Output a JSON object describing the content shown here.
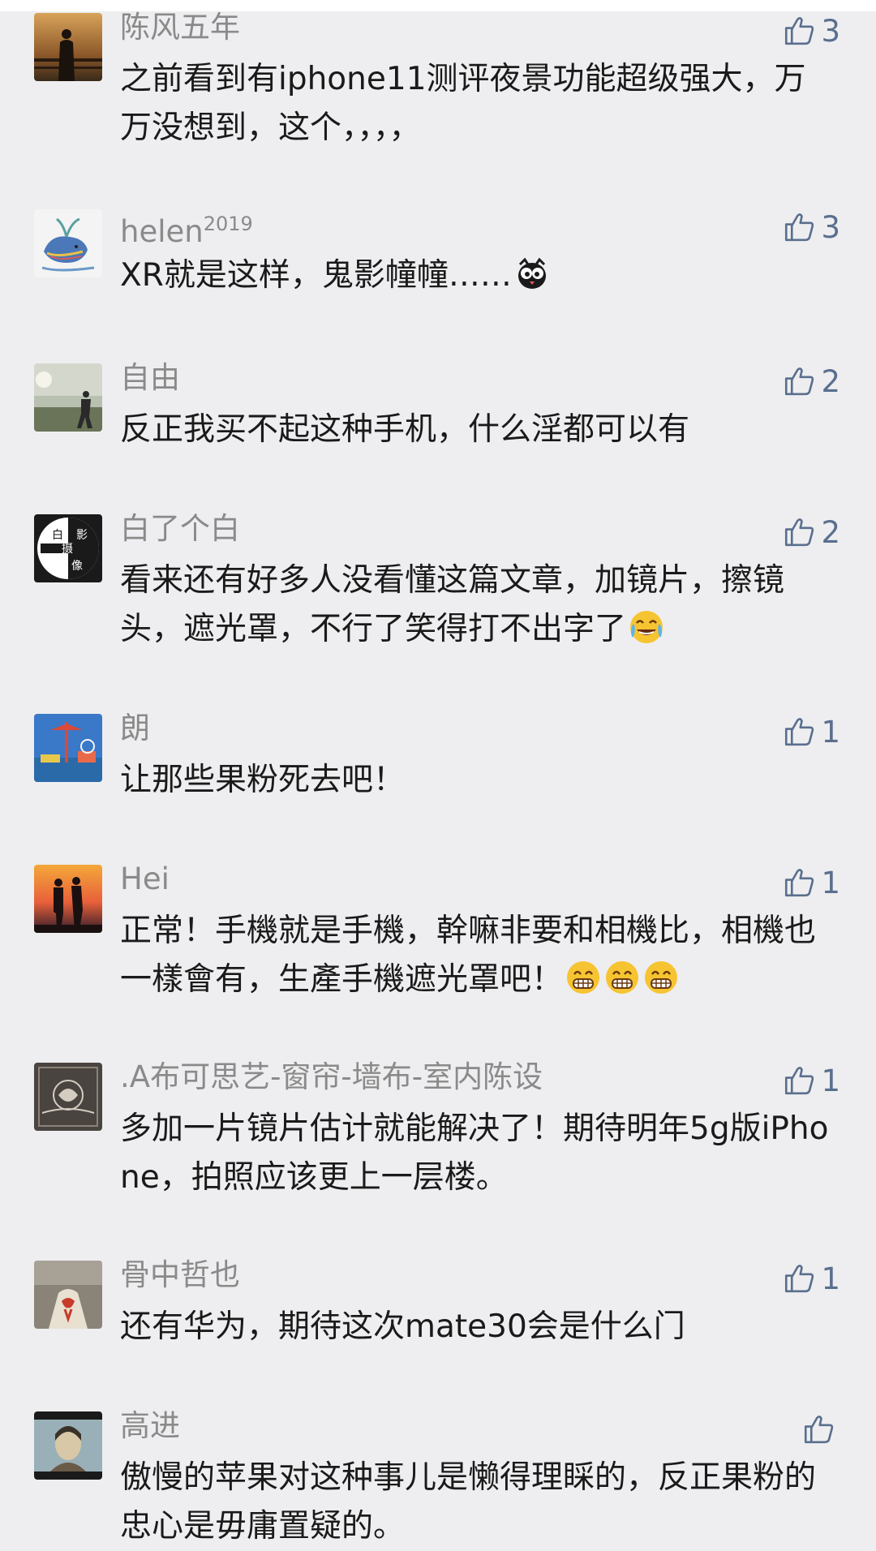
{
  "comments": [
    {
      "name": "陈风五年",
      "name_sup": "",
      "text": "之前看到有iphone11测评夜景功能超级强大，万万没想到，这个，，，，",
      "likes": "3",
      "avatar": "silhouette-sunset-avatar",
      "emoji": []
    },
    {
      "name": "helen",
      "name_sup": "2019",
      "text": "XR就是这样，鬼影幢幢……",
      "likes": "3",
      "avatar": "whale-drawing-avatar",
      "emoji": [
        "owl-emoji"
      ]
    },
    {
      "name": "自由",
      "name_sup": "",
      "text": "反正我买不起这种手机，什么淫都可以有",
      "likes": "2",
      "avatar": "person-by-lake-avatar",
      "emoji": []
    },
    {
      "name": "白了个白",
      "name_sup": "",
      "text": "看来还有好多人没看懂这篇文章，加镜片，擦镜头，遮光罩，不行了笑得打不出字了",
      "likes": "2",
      "avatar": "photography-logo-avatar",
      "emoji": [
        "tears-of-joy-emoji"
      ]
    },
    {
      "name": "朗",
      "name_sup": "",
      "text": "让那些果粉死去吧！",
      "likes": "1",
      "avatar": "amusement-park-avatar",
      "emoji": []
    },
    {
      "name": "Hei",
      "name_sup": "",
      "text": "正常！手機就是手機，幹嘛非要和相機比，相機也一樣會有，生產手機遮光罩吧！",
      "likes": "1",
      "avatar": "couple-sunset-avatar",
      "emoji": [
        "grinning-emoji",
        "grinning-emoji",
        "grinning-emoji"
      ]
    },
    {
      "name": ".A布可思艺-窗帘-墙布-室内陈设",
      "name_sup": "",
      "text": "多加一片镜片估计就能解决了！期待明年5g版iPhone，拍照应该更上一层楼。",
      "likes": "1",
      "avatar": "brand-logo-avatar",
      "emoji": []
    },
    {
      "name": "骨中哲也",
      "name_sup": "",
      "text": "还有华为，期待这次mate30会是什么门",
      "likes": "1",
      "avatar": "hands-art-avatar",
      "emoji": []
    },
    {
      "name": "高进",
      "name_sup": "",
      "text": "傲慢的苹果对这种事儿是懒得理睬的，反正果粉的忠心是毋庸置疑的。",
      "likes": "",
      "avatar": "portrait-avatar",
      "emoji": []
    }
  ],
  "icons": {
    "like": "thumbs-up-icon"
  },
  "colors": {
    "background": "#eeeef0",
    "name": "#8a8a8a",
    "text": "#1a1a1a",
    "like": "#5a6f8e"
  }
}
